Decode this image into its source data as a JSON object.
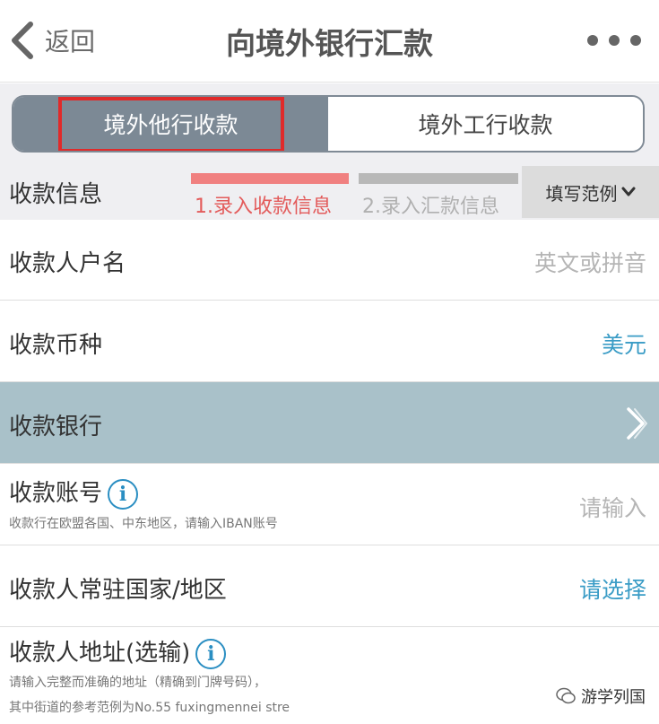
{
  "nav": {
    "back_label": "返回",
    "title": "向境外银行汇款"
  },
  "segment": {
    "tabs": [
      {
        "label": "境外他行收款",
        "active": true
      },
      {
        "label": "境外工行收款",
        "active": false
      }
    ]
  },
  "steps": {
    "section_label": "收款信息",
    "step1": "1.录入收款信息",
    "step2": "2.录入汇款信息",
    "example_label": "填写范例"
  },
  "form": {
    "payee_name": {
      "label": "收款人户名",
      "placeholder": "英文或拼音"
    },
    "currency": {
      "label": "收款币种",
      "value": "美元"
    },
    "bank": {
      "label": "收款银行"
    },
    "account": {
      "label": "收款账号",
      "hint": "收款行在欧盟各国、中东地区，请输入IBAN账号",
      "placeholder": "请输入"
    },
    "country": {
      "label": "收款人常驻国家/地区",
      "value": "请选择"
    },
    "address": {
      "label": "收款人地址(选输)",
      "hint1": "请输入完整而准确的地址（精确到门牌号码），",
      "hint2": "其中街道的参考范例为No.55 fuxingmennei stre"
    }
  },
  "watermark": {
    "text": "游学列国"
  },
  "colors": {
    "accent": "#2a8ec2",
    "segment_active": "#7c8995",
    "highlight": "#e02a2a",
    "step_active": "#e35b5b",
    "selected_row": "#a9c1c9"
  }
}
